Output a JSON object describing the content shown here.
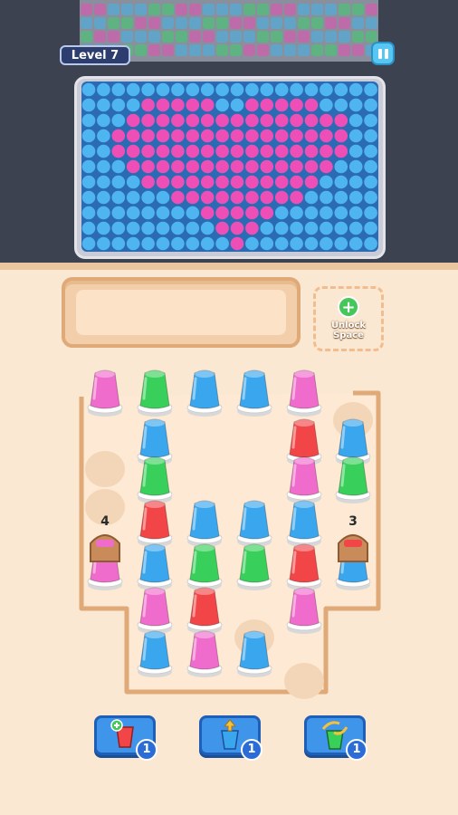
{
  "header": {
    "level_label": "Level 7"
  },
  "unlock": {
    "label": "Unlock Space",
    "icon": "plus-icon"
  },
  "picture": {
    "top_strip_colors": [
      "#e84fb3",
      "#3fb6ea",
      "#3ccf6a"
    ],
    "grid_colors": {
      "blue": "#4fb5f0",
      "pink": "#ee4fb7"
    },
    "shape": "heart"
  },
  "board": {
    "left_marker_count": "4",
    "right_marker_count": "3",
    "cup_colors": {
      "pink": "#f06ccc",
      "green": "#38d05a",
      "blue": "#3aa6ee",
      "red": "#f24547"
    },
    "cups": [
      {
        "row": 0,
        "col": 0,
        "color": "pink"
      },
      {
        "row": 0,
        "col": 1,
        "color": "green"
      },
      {
        "row": 0,
        "col": 2,
        "color": "blue"
      },
      {
        "row": 0,
        "col": 3,
        "color": "blue"
      },
      {
        "row": 0,
        "col": 4,
        "color": "pink"
      },
      {
        "row": 1,
        "col": 1,
        "color": "blue"
      },
      {
        "row": 1,
        "col": 4,
        "color": "red"
      },
      {
        "row": 1,
        "col": 5,
        "color": "blue"
      },
      {
        "row": 2,
        "col": 1,
        "color": "green"
      },
      {
        "row": 2,
        "col": 4,
        "color": "pink"
      },
      {
        "row": 2,
        "col": 5,
        "color": "green"
      },
      {
        "row": 3,
        "col": 1,
        "color": "red"
      },
      {
        "row": 3,
        "col": 2,
        "color": "blue"
      },
      {
        "row": 3,
        "col": 3,
        "color": "blue"
      },
      {
        "row": 3,
        "col": 4,
        "color": "blue"
      },
      {
        "row": 4,
        "col": 0,
        "color": "pink"
      },
      {
        "row": 4,
        "col": 1,
        "color": "blue"
      },
      {
        "row": 4,
        "col": 2,
        "color": "green"
      },
      {
        "row": 4,
        "col": 3,
        "color": "green"
      },
      {
        "row": 4,
        "col": 4,
        "color": "red"
      },
      {
        "row": 4,
        "col": 5,
        "color": "blue"
      },
      {
        "row": 5,
        "col": 1,
        "color": "pink"
      },
      {
        "row": 5,
        "col": 2,
        "color": "red"
      },
      {
        "row": 5,
        "col": 4,
        "color": "pink"
      },
      {
        "row": 6,
        "col": 1,
        "color": "blue"
      },
      {
        "row": 6,
        "col": 2,
        "color": "pink"
      },
      {
        "row": 6,
        "col": 3,
        "color": "blue"
      }
    ]
  },
  "boosters": [
    {
      "name": "add-cup-booster",
      "icon": "red-cup-plus-icon",
      "count": "1"
    },
    {
      "name": "lift-cup-booster",
      "icon": "blue-cup-arrow-icon",
      "count": "1"
    },
    {
      "name": "shuffle-cup-booster",
      "icon": "green-cup-swap-icon",
      "count": "1"
    }
  ]
}
